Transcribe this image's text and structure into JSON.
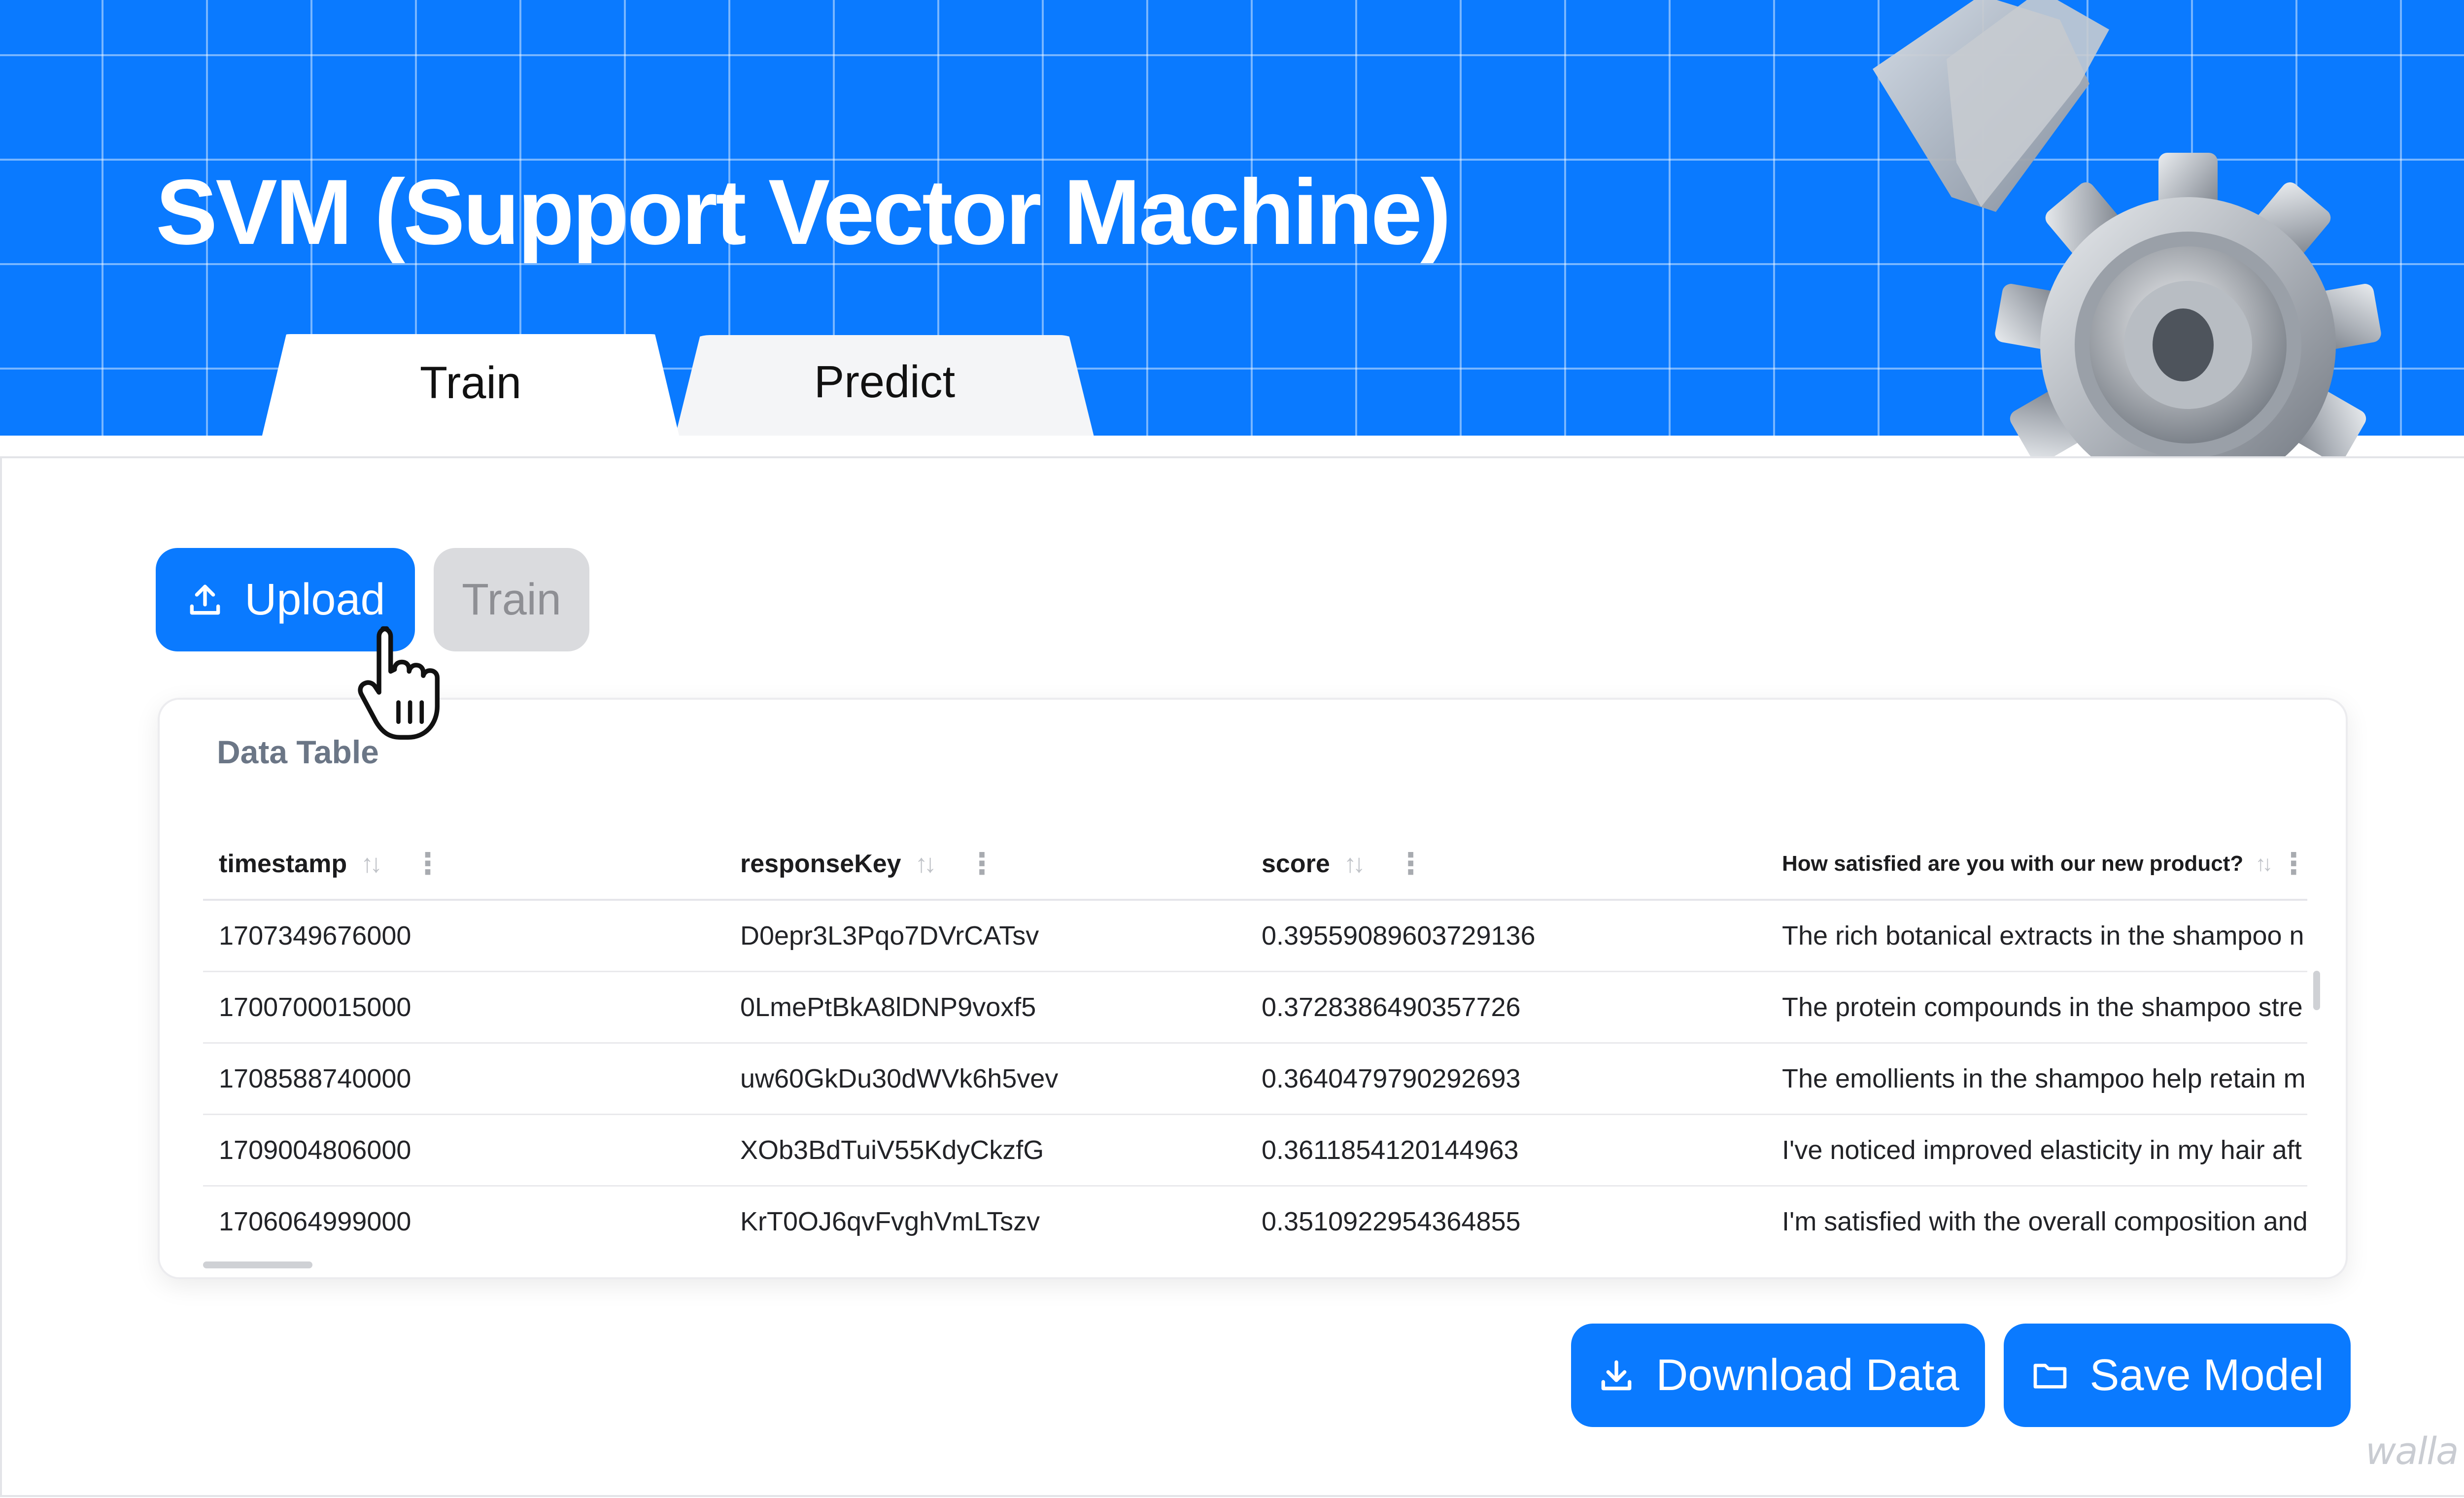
{
  "app": {
    "title": "SVM (Support Vector Machine)",
    "tabs": [
      {
        "label": "Train",
        "active": true
      },
      {
        "label": "Predict",
        "active": false
      }
    ],
    "accent_color": "#0a7aff"
  },
  "actions": {
    "upload_label": "Upload",
    "upload_icon": "upload-icon",
    "train_label": "Train",
    "train_enabled": false,
    "download_label": "Download Data",
    "download_icon": "download-icon",
    "save_label": "Save Model",
    "save_icon": "folder-icon"
  },
  "table": {
    "title": "Data Table",
    "columns": [
      {
        "label": "timestamp"
      },
      {
        "label": "responseKey"
      },
      {
        "label": "score"
      },
      {
        "label": "How satisfied are you with our new product?"
      }
    ],
    "rows": [
      [
        "1707349676000",
        "D0epr3L3Pqo7DVrCATsv",
        "0.39559089603729136",
        "The rich botanical extracts in the shampoo n"
      ],
      [
        "1700700015000",
        "0LmePtBkA8lDNP9voxf5",
        "0.3728386490357726",
        "The protein compounds in the shampoo stre"
      ],
      [
        "1708588740000",
        "uw60GkDu30dWVk6h5vev",
        "0.3640479790292693",
        "The emollients in the shampoo help retain m"
      ],
      [
        "1709004806000",
        "XOb3BdTuiV55KdyCkzfG",
        "0.3611854120144963",
        "I've noticed improved elasticity in my hair aft"
      ],
      [
        "1706064999000",
        "KrT0OJ6qvFvghVmLTszv",
        "0.3510922954364855",
        "I'm satisfied with the overall composition and"
      ]
    ]
  },
  "watermark": "walla"
}
